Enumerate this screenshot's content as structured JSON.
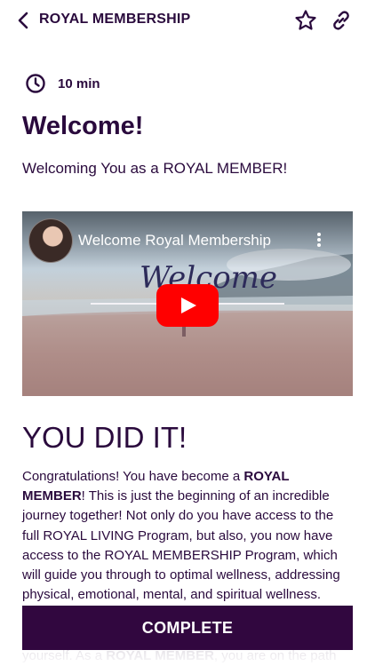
{
  "header": {
    "title": "ROYAL MEMBERSHIP"
  },
  "lesson": {
    "duration": "10 min",
    "title": "Welcome!",
    "subtitle": "Welcoming You as a ROYAL MEMBER!"
  },
  "video": {
    "title": "Welcome Royal Membership",
    "overlay_text": "Welcome"
  },
  "content": {
    "heading": "YOU DID IT!",
    "paragraph_1": "Congratulations! You have become a ",
    "paragraph_1_bold": "ROYAL MEMBER",
    "paragraph_1_rest": "! This is just the beginning of an incredible journey together! Not only do you have access to the full ROYAL LIVING Program, but also, you now have access to the ROYAL MEMBERSHIP Program, which will guide you through to optimal wellness, addressing physical, emotional, mental, and spiritual wellness.",
    "paragraph_2_start": "yourself. As a ",
    "paragraph_2_bold": "ROYAL MEMBER",
    "paragraph_2_rest": ", you are on the path"
  },
  "footer": {
    "complete_label": "COMPLETE"
  },
  "colors": {
    "primary": "#31073f",
    "text": "#2a0a3d",
    "play": "#ff0000"
  },
  "icons": [
    "back-arrow-icon",
    "star-icon",
    "link-icon",
    "clock-icon",
    "more-vertical-icon",
    "play-icon"
  ]
}
